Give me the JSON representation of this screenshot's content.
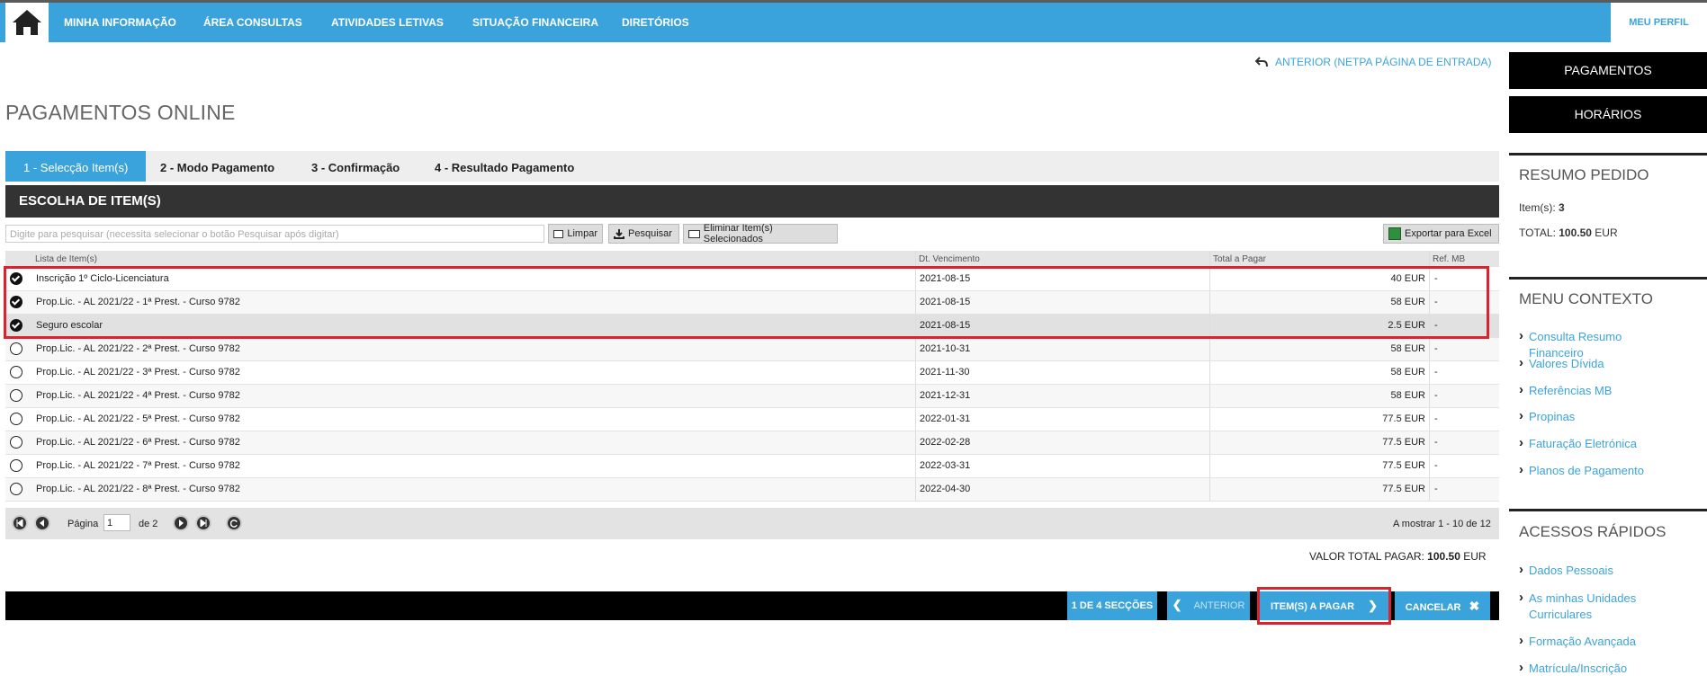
{
  "nav": {
    "items": [
      "MINHA INFORMAÇÃO",
      "ÁREA CONSULTAS",
      "ATIVIDADES LETIVAS",
      "SITUAÇÃO FINANCEIRA",
      "DIRETÓRIOS"
    ],
    "profile": "MEU PERFIL"
  },
  "back_link": "ANTERIOR (NETPA PÁGINA DE ENTRADA)",
  "page_title": "PAGAMENTOS ONLINE",
  "tabs": [
    "1 - Selecção Item(s)",
    "2 - Modo Pagamento",
    "3 - Confirmação",
    "4 - Resultado Pagamento"
  ],
  "section_title": "ESCOLHA DE ITEM(S)",
  "search": {
    "placeholder": "Digite para pesquisar (necessita selecionar o botão Pesquisar após digitar)",
    "clear": "Limpar",
    "search": "Pesquisar",
    "remove_selected": "Eliminar Item(s) Selecionados",
    "export": "Exportar para Excel"
  },
  "table": {
    "columns": [
      "Lista de Item(s)",
      "Dt. Vencimento",
      "Total a Pagar",
      "Ref. MB"
    ],
    "rows": [
      {
        "item": "Inscrição 1º Ciclo-Licenciatura",
        "due": "2021-08-15",
        "total": "40 EUR",
        "ref": "-",
        "selected": true
      },
      {
        "item": "Prop.Lic. - AL 2021/22 - 1ª Prest. - Curso 9782",
        "due": "2021-08-15",
        "total": "58 EUR",
        "ref": "-",
        "selected": true
      },
      {
        "item": "Seguro escolar",
        "due": "2021-08-15",
        "total": "2.5 EUR",
        "ref": "-",
        "selected": true
      },
      {
        "item": "Prop.Lic. - AL 2021/22 - 2ª Prest. - Curso 9782",
        "due": "2021-10-31",
        "total": "58 EUR",
        "ref": "-",
        "selected": false
      },
      {
        "item": "Prop.Lic. - AL 2021/22 - 3ª Prest. - Curso 9782",
        "due": "2021-11-30",
        "total": "58 EUR",
        "ref": "-",
        "selected": false
      },
      {
        "item": "Prop.Lic. - AL 2021/22 - 4ª Prest. - Curso 9782",
        "due": "2021-12-31",
        "total": "58 EUR",
        "ref": "-",
        "selected": false
      },
      {
        "item": "Prop.Lic. - AL 2021/22 - 5ª Prest. - Curso 9782",
        "due": "2022-01-31",
        "total": "77.5 EUR",
        "ref": "-",
        "selected": false
      },
      {
        "item": "Prop.Lic. - AL 2021/22 - 6ª Prest. - Curso 9782",
        "due": "2022-02-28",
        "total": "77.5 EUR",
        "ref": "-",
        "selected": false
      },
      {
        "item": "Prop.Lic. - AL 2021/22 - 7ª Prest. - Curso 9782",
        "due": "2022-03-31",
        "total": "77.5 EUR",
        "ref": "-",
        "selected": false
      },
      {
        "item": "Prop.Lic. - AL 2021/22 - 8ª Prest. - Curso 9782",
        "due": "2022-04-30",
        "total": "77.5 EUR",
        "ref": "-",
        "selected": false
      }
    ]
  },
  "pager": {
    "page_label": "Página",
    "page_value": "1",
    "of_label": "de 2",
    "showing": "A mostrar 1 - 10 de 12"
  },
  "total": {
    "label": "VALOR TOTAL PAGAR:",
    "value": "100.50",
    "currency": "EUR"
  },
  "actions": {
    "sections": "1 DE 4 SECÇÕES",
    "previous": "ANTERIOR",
    "next": "ITEM(S) A PAGAR",
    "cancel": "CANCELAR"
  },
  "sidebar": {
    "buttons": [
      "PAGAMENTOS",
      "HORÁRIOS"
    ],
    "summary_title": "RESUMO PEDIDO",
    "items_label": "Item(s):",
    "items_value": "3",
    "total_label": "TOTAL:",
    "total_value": "100.50",
    "total_currency": "EUR",
    "context_title": "MENU CONTEXTO",
    "context_links": [
      "Consulta Resumo Financeiro",
      "Valores Dívida",
      "Referências MB",
      "Propinas",
      "Faturação Eletrónica",
      "Planos de Pagamento"
    ],
    "quick_title": "ACESSOS RÁPIDOS",
    "quick_links": [
      "Dados Pessoais",
      "As minhas Unidades Curriculares",
      "Formação Avançada",
      "Matrícula/Inscrição"
    ]
  },
  "colors": {
    "accent": "#3ba3dc",
    "highlight": "#d9232e",
    "dark": "#333333"
  }
}
